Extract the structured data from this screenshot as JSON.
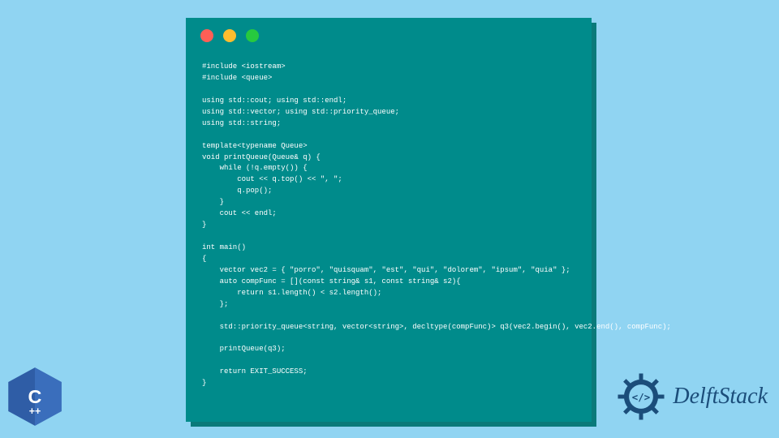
{
  "window": {
    "dots": [
      "red",
      "yellow",
      "green"
    ]
  },
  "code": {
    "lines": [
      "#include <iostream>",
      "#include <queue>",
      "",
      "using std::cout; using std::endl;",
      "using std::vector; using std::priority_queue;",
      "using std::string;",
      "",
      "template<typename Queue>",
      "void printQueue(Queue& q) {",
      "    while (!q.empty()) {",
      "        cout << q.top() << \", \";",
      "        q.pop();",
      "    }",
      "    cout << endl;",
      "}",
      "",
      "int main()",
      "{",
      "    vector vec2 = { \"porro\", \"quisquam\", \"est\", \"qui\", \"dolorem\", \"ipsum\", \"quia\" };",
      "    auto compFunc = [](const string& s1, const string& s2){",
      "        return s1.length() < s2.length();",
      "    };",
      "",
      "    std::priority_queue<string, vector<string>, decltype(compFunc)> q3(vec2.begin(), vec2.end(), compFunc);",
      "",
      "    printQueue(q3);",
      "",
      "    return EXIT_SUCCESS;",
      "}"
    ]
  },
  "cpp_badge": {
    "label": "C++"
  },
  "brand": {
    "name": "DelftStack"
  },
  "colors": {
    "page_bg": "#90d4f2",
    "window_bg": "#008b8b",
    "code_fg": "#ffffff",
    "cpp_blue": "#2f5da6",
    "delft_blue": "#1b4d7a",
    "dot_red": "#ff5f56",
    "dot_yellow": "#ffbd2e",
    "dot_green": "#27c93f"
  }
}
